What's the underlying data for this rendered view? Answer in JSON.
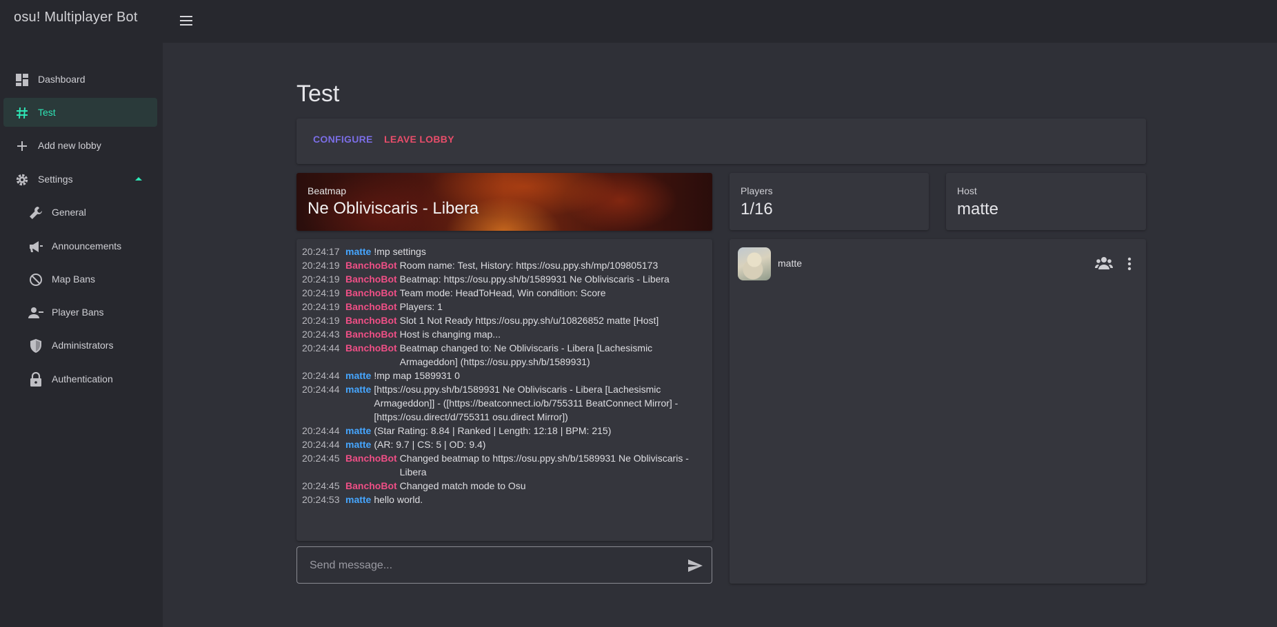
{
  "app": {
    "title": "osu! Multiplayer Bot"
  },
  "sidebar": {
    "items": [
      {
        "label": "Dashboard",
        "icon": "dashboard-icon"
      },
      {
        "label": "Test",
        "icon": "hash-icon",
        "active": true
      },
      {
        "label": "Add new lobby",
        "icon": "plus-icon"
      },
      {
        "label": "Settings",
        "icon": "gear-icon",
        "expanded": true
      },
      {
        "label": "General",
        "icon": "wrench-icon"
      },
      {
        "label": "Announcements",
        "icon": "megaphone-icon"
      },
      {
        "label": "Map Bans",
        "icon": "block-icon"
      },
      {
        "label": "Player Bans",
        "icon": "person-remove-icon"
      },
      {
        "label": "Administrators",
        "icon": "shield-icon"
      },
      {
        "label": "Authentication",
        "icon": "lock-icon"
      }
    ]
  },
  "page": {
    "title": "Test"
  },
  "actions": {
    "configure": "CONFIGURE",
    "leave": "LEAVE LOBBY"
  },
  "beatmap": {
    "caption": "Beatmap",
    "value": "Ne Obliviscaris - Libera"
  },
  "players": {
    "caption": "Players",
    "value": "1/16"
  },
  "host": {
    "caption": "Host",
    "value": "matte"
  },
  "chat": {
    "messages": [
      {
        "time": "20:24:17",
        "user": "matte",
        "text": "!mp settings"
      },
      {
        "time": "20:24:19",
        "user": "BanchoBot",
        "text": "Room name: Test, History: https://osu.ppy.sh/mp/109805173"
      },
      {
        "time": "20:24:19",
        "user": "BanchoBot",
        "text": "Beatmap: https://osu.ppy.sh/b/1589931 Ne Obliviscaris - Libera"
      },
      {
        "time": "20:24:19",
        "user": "BanchoBot",
        "text": "Team mode: HeadToHead, Win condition: Score"
      },
      {
        "time": "20:24:19",
        "user": "BanchoBot",
        "text": "Players: 1"
      },
      {
        "time": "20:24:19",
        "user": "BanchoBot",
        "text": "Slot 1 Not Ready https://osu.ppy.sh/u/10826852 matte [Host]"
      },
      {
        "time": "20:24:43",
        "user": "BanchoBot",
        "text": "Host is changing map..."
      },
      {
        "time": "20:24:44",
        "user": "BanchoBot",
        "text": "Beatmap changed to: Ne Obliviscaris - Libera [Lachesismic Armageddon] (https://osu.ppy.sh/b/1589931)"
      },
      {
        "time": "20:24:44",
        "user": "matte",
        "text": "!mp map 1589931 0"
      },
      {
        "time": "20:24:44",
        "user": "matte",
        "text": "[https://osu.ppy.sh/b/1589931 Ne Obliviscaris - Libera [Lachesismic Armageddon]] - ([https://beatconnect.io/b/755311 BeatConnect Mirror] - [https://osu.direct/d/755311 osu.direct Mirror])"
      },
      {
        "time": "20:24:44",
        "user": "matte",
        "text": "(Star Rating: 8.84 | Ranked | Length: 12:18 | BPM: 215)"
      },
      {
        "time": "20:24:44",
        "user": "matte",
        "text": "(AR: 9.7 | CS: 5 | OD: 9.4)"
      },
      {
        "time": "20:24:45",
        "user": "BanchoBot",
        "text": "Changed beatmap to https://osu.ppy.sh/b/1589931 Ne Obliviscaris - Libera"
      },
      {
        "time": "20:24:45",
        "user": "BanchoBot",
        "text": "Changed match mode to Osu"
      },
      {
        "time": "20:24:53",
        "user": "matte",
        "text": "hello world."
      }
    ],
    "input_placeholder": "Send message..."
  },
  "player_list": [
    {
      "name": "matte"
    }
  ],
  "colors": {
    "accent": "#2ee6b6",
    "configure": "#7b6ee6",
    "leave": "#e84d6a",
    "user_matte": "#46a6ff",
    "user_bancho": "#ef4f86"
  }
}
